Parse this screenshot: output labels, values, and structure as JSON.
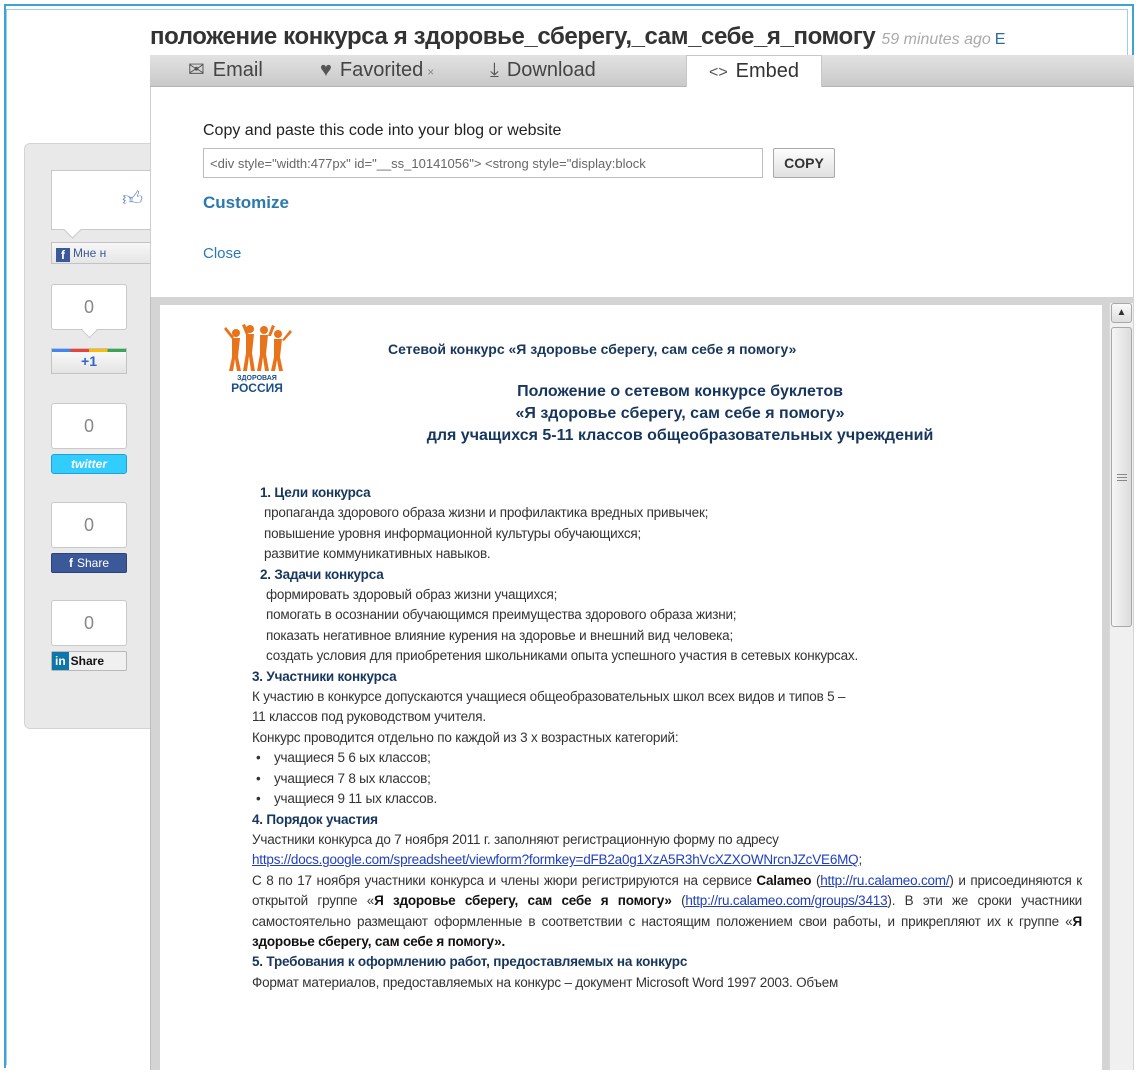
{
  "header": {
    "title": "положение конкурса я здоровье_сберегу,_сам_себе_я_помогу",
    "time_ago": "59 minutes ago",
    "cut_text": "E"
  },
  "tabs": [
    {
      "label": "Email",
      "icon": "envelope-icon"
    },
    {
      "label": "Favorited",
      "icon": "heart-icon",
      "suffix": "×"
    },
    {
      "label": "Download",
      "icon": "download-icon"
    },
    {
      "label": "Embed",
      "icon": "code-icon"
    }
  ],
  "embed": {
    "prompt": "Copy and paste this code into your blog or website",
    "code_value": "<div style=\"width:477px\" id=\"__ss_10141056\"> <strong style=\"display:block",
    "copy_label": "COPY",
    "customize_label": "Customize",
    "close_label": "Close"
  },
  "social": {
    "fb_like_label": "Мне н",
    "gplus_count": "0",
    "gplus_label": "+1",
    "twitter_count": "0",
    "twitter_label": "twitter",
    "fb_share_count": "0",
    "fb_share_label": "Share",
    "linkedin_count": "0",
    "linkedin_label": "Share",
    "colors": {
      "facebook": "#3b5998",
      "twitter": "#33ccff",
      "linkedin": "#0e76a8"
    }
  },
  "document": {
    "logo_small": "ЗДОРОВАЯ",
    "logo_big": "РОССИЯ",
    "head": "Сетевой конкурс «Я здоровье сберегу, сам себе я помогу»",
    "title_lines": [
      "Положение о сетевом конкурсе буклетов",
      "«Я здоровье сберегу, сам себе я помогу»",
      "для учащихся 5-11 классов общеобразовательных учреждений"
    ],
    "s1_head": "1. Цели конкурса",
    "s1_items": [
      "пропаганда здорового образа жизни и профилактика вредных привычек;",
      "повышение уровня информационной культуры обучающихся;",
      "развитие коммуникативных навыков."
    ],
    "s2_head": "2. Задачи конкурса",
    "s2_items": [
      "формировать здоровый образ жизни учащихся;",
      "помогать в осознании обучающимся преимущества здорового образа жизни;",
      "показать негативное влияние курения на здоровье и внешний вид человека;",
      "создать условия для приобретения школьниками опыта успешного участия в сетевых конкурсах."
    ],
    "s3_head": "3. Участники конкурса",
    "s3_p1a": "К участию в конкурсе допускаются учащиеся общеобразовательных школ всех видов и типов 5 –",
    "s3_p1b": "11 классов под руководством учителя.",
    "s3_p2": "Конкурс проводится отдельно по каждой из 3 х возрастных категорий:",
    "s3_bullets": [
      "учащиеся 5 6 ых классов;",
      "учащиеся 7 8 ых классов;",
      "учащиеся 9 11 ых классов."
    ],
    "s4_head": "4. Порядок участия",
    "s4_p1": "Участники конкурса до 7 ноября 2011 г. заполняют регистрационную форму по адресу",
    "s4_link1": "https://docs.google.com/spreadsheet/viewform?formkey=dFB2a0g1XzA5R3hVcXZXOWNrcnJZcVE6MQ",
    "s4_p2": "С 8 по 17 ноября участники конкурса и члены жюри регистрируются на сервисе",
    "s4_calameo": "Calameo",
    "s4_link2": "http://ru.calameo.com/",
    "s4_p3": ") и присоединяются к открытой группе «",
    "s4_group": "Я здоровье сберегу, сам себе я помогу»",
    "s4_link3": "http://ru.calameo.com/groups/3413",
    "s4_p4": "). В эти же сроки участники самостоятельно размещают оформленные в соответствии с настоящим положением свои работы, и прикрепляют их к группе «",
    "s4_group2": "Я здоровье сберегу, сам себе я помогу».",
    "s5_head": "5. Требования к оформлению работ, предоставляемых на конкурс",
    "s5_p1": "Формат материалов, предоставляемых на конкурс – документ Microsoft Word 1997 2003. Объем"
  }
}
